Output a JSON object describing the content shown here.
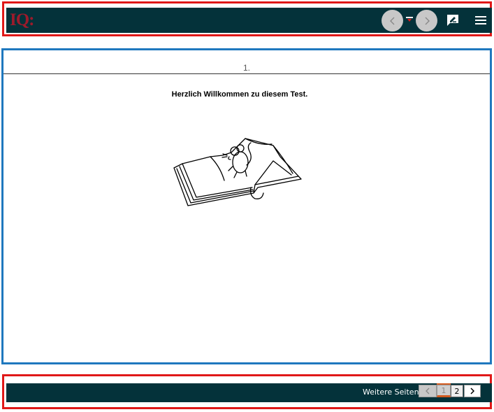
{
  "header": {
    "logo_text": "IQ:",
    "prev_icon": "chevron-left-icon",
    "next_icon": "chevron-right-icon",
    "comment_icon": "comment-edit-icon",
    "menu_icon": "hamburger-menu-icon",
    "bar_color": "#04323a",
    "logo_color": "#9b1b2b"
  },
  "unit": {
    "page_number": "1.",
    "welcome_text": "Herzlich Willkommen zu diesem Test.",
    "illustration": "mouse-on-open-book-image"
  },
  "footer": {
    "more_pages_label": "Weitere Seiten:",
    "pages": [
      "1",
      "2"
    ],
    "active_page": "1",
    "accent_color": "#d25a1e"
  }
}
